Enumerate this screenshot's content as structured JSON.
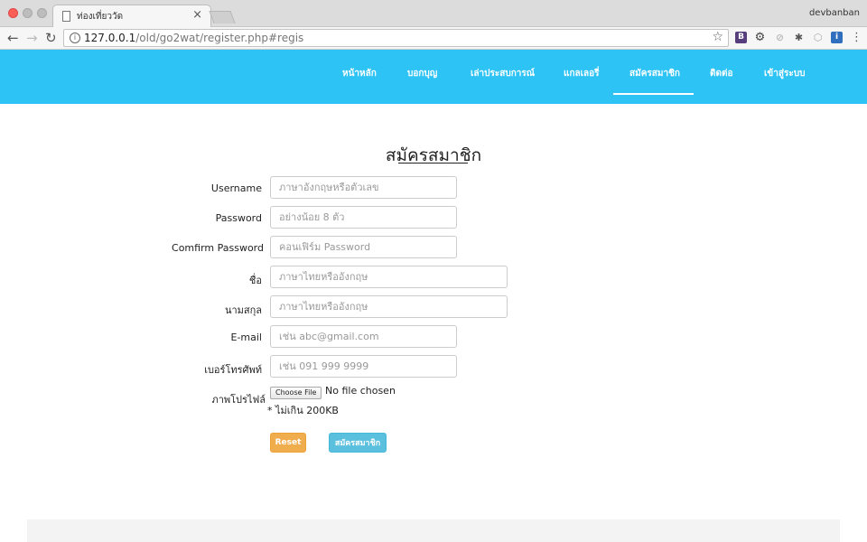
{
  "browser": {
    "tab_title": "ท่องเที่ยววัด",
    "tab_close": "×",
    "profile_name": "devbanban",
    "url_host": "127.0.0.1",
    "url_path": "/old/go2wat/register.php#regis",
    "icons": [
      "back-arrow-icon",
      "forward-arrow-icon",
      "reload-icon",
      "info-icon",
      "star-icon"
    ]
  },
  "navbar": {
    "color": "#2ec3f5",
    "items": [
      {
        "label": "หน้าหลัก"
      },
      {
        "label": "บอกบุญ"
      },
      {
        "label": "เล่าประสบการณ์"
      },
      {
        "label": "แกลเลอรี่"
      },
      {
        "label": "สมัครสมาชิก",
        "active": true
      },
      {
        "label": "ติดต่อ"
      },
      {
        "label": "เข้าสู่ระบบ"
      }
    ]
  },
  "form": {
    "title": "สมัครสมาชิก",
    "fields": [
      {
        "label": "Username",
        "placeholder": "ภาษาอังกฤษหรือตัวเลข",
        "value": ""
      },
      {
        "label": "Password",
        "placeholder": "อย่างน้อย 8 ตัว",
        "value": ""
      },
      {
        "label": "Comfirm  Password",
        "placeholder": "คอนเฟิร์ม Password",
        "value": ""
      },
      {
        "label": "ชื่อ",
        "placeholder": "ภาษาไทยหรืออังกฤษ",
        "value": ""
      },
      {
        "label": "นามสกุล",
        "placeholder": "ภาษาไทยหรืออังกฤษ",
        "value": ""
      },
      {
        "label": "E-mail",
        "placeholder": "เช่น abc@gmail.com",
        "value": ""
      },
      {
        "label": "เบอร์โทรศัพท์",
        "placeholder": "เช่น 091 999 9999",
        "value": ""
      }
    ],
    "photo": {
      "label": "ภาพโปรไฟล์",
      "button": "Choose File",
      "status": "No file chosen",
      "note": "* ไม่เกิน 200KB"
    },
    "buttons": {
      "reset": "Reset",
      "submit": "สมัครสมาชิก",
      "reset_color": "#f0ad4e",
      "submit_color": "#5bc0de"
    }
  }
}
